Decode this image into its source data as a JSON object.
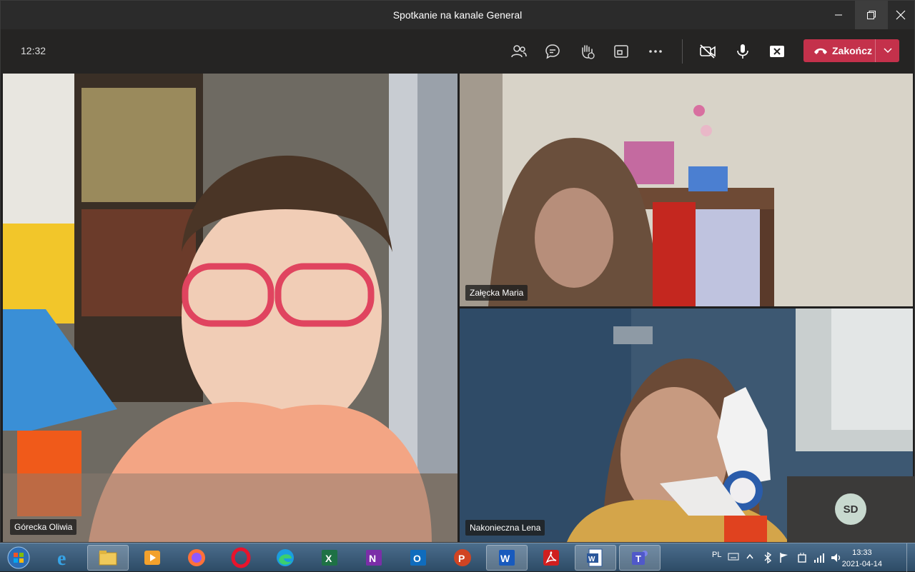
{
  "window": {
    "title": "Spotkanie na kanale General"
  },
  "toolbar": {
    "time": "12:32",
    "end_label": "Zakończ",
    "icons": [
      "participants-icon",
      "chat-icon",
      "raise-hand-icon",
      "share-tray-icon",
      "more-actions-icon",
      "camera-off-icon",
      "mic-icon",
      "stop-sharing-icon"
    ]
  },
  "participants": [
    {
      "name": "Górecka Oliwia"
    },
    {
      "name": "Załęcka Maria"
    },
    {
      "name": "Nakonieczna Lena"
    },
    {
      "initials": "SD"
    }
  ],
  "taskbar": {
    "language": "PL",
    "time": "13:33",
    "date": "2021-04-14",
    "apps": [
      "start-orb",
      "internet-explorer",
      "file-explorer",
      "media-player",
      "firefox",
      "opera",
      "edge",
      "excel",
      "onenote",
      "outlook",
      "powerpoint",
      "word",
      "acrobat-reader",
      "word-document",
      "teams"
    ]
  },
  "colors": {
    "end_call": "#c4314b",
    "titlebar": "#2b2b2b",
    "toolbar": "#252423"
  }
}
